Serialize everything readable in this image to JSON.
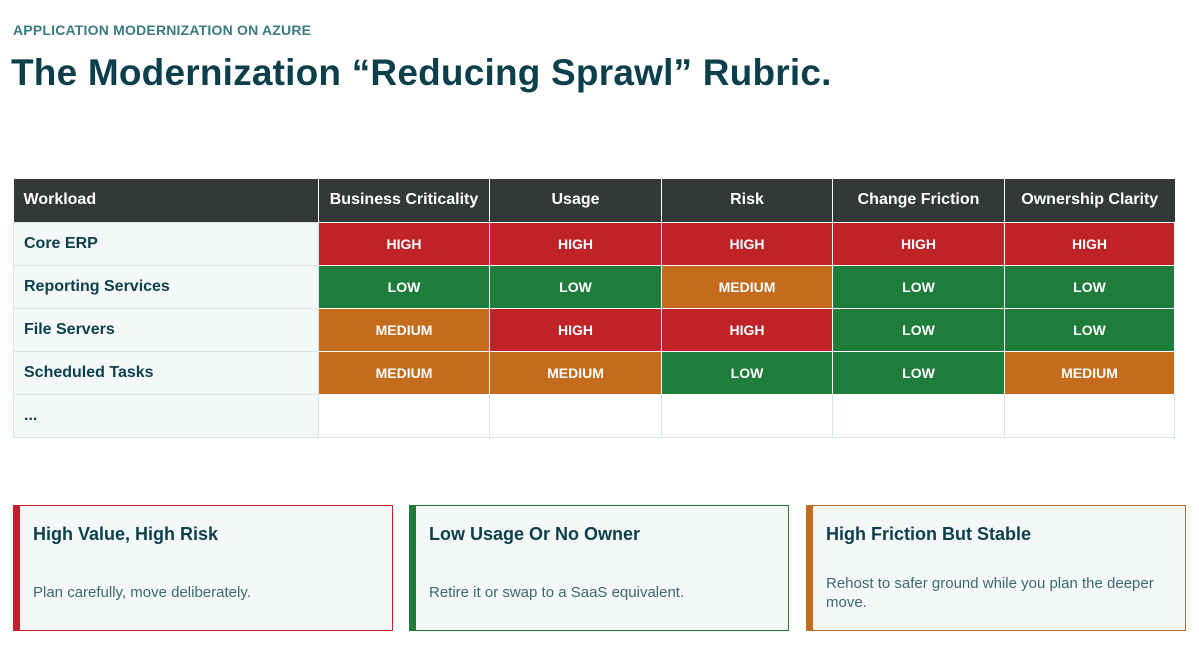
{
  "header": {
    "eyebrow": "APPLICATION MODERNIZATION ON AZURE",
    "title": "The Modernization “Reducing Sprawl” Rubric."
  },
  "rubric": {
    "columns": [
      "Workload",
      "Business Criticality",
      "Usage",
      "Risk",
      "Change Friction",
      "Ownership Clarity"
    ],
    "rows": [
      {
        "workload": "Core ERP",
        "ratings": [
          "HIGH",
          "HIGH",
          "HIGH",
          "HIGH",
          "HIGH"
        ]
      },
      {
        "workload": "Reporting Services",
        "ratings": [
          "LOW",
          "LOW",
          "MEDIUM",
          "LOW",
          "LOW"
        ]
      },
      {
        "workload": "File Servers",
        "ratings": [
          "MEDIUM",
          "HIGH",
          "HIGH",
          "LOW",
          "LOW"
        ]
      },
      {
        "workload": "Scheduled Tasks",
        "ratings": [
          "MEDIUM",
          "MEDIUM",
          "LOW",
          "LOW",
          "MEDIUM"
        ]
      },
      {
        "workload": "...",
        "ratings": [
          "",
          "",
          "",
          "",
          ""
        ]
      }
    ],
    "colors": {
      "HIGH": "#bf2227",
      "LOW": "#1f7d3b",
      "MEDIUM": "#c56b1c"
    }
  },
  "cards": [
    {
      "title": "High Value, High Risk",
      "body": "Plan carefully, move deliberately.",
      "accent": "#bf2227"
    },
    {
      "title": "Low Usage Or No Owner",
      "body": "Retire it or swap to a SaaS equivalent.",
      "accent": "#1f7d3b"
    },
    {
      "title": "High Friction But Stable",
      "body": "Rehost to safer ground while you plan the deeper move.",
      "accent": "#c56b1c"
    }
  ]
}
